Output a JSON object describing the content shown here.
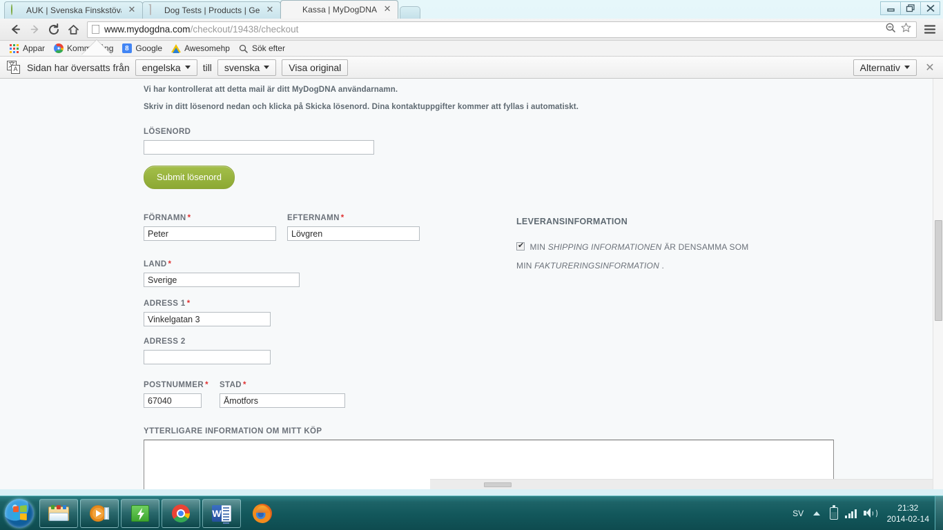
{
  "browser": {
    "tabs": [
      {
        "title": "AUK | Svenska Finskstövar",
        "favicon": "auk-logo-icon",
        "active": false
      },
      {
        "title": "Dog Tests | Products | Gen",
        "favicon": "document-icon",
        "active": false
      },
      {
        "title": "Kassa | MyDogDNA",
        "favicon": "mydogdna-logo-icon",
        "active": true
      }
    ],
    "close_label": "✕",
    "window_controls": {
      "minimize": "minimize-icon",
      "restore": "restore-icon",
      "close": "close-icon"
    },
    "url": {
      "host": "www.mydogdna.com",
      "path": "/checkout/19438/checkout"
    },
    "bookmarks": [
      {
        "label": "Appar",
        "icon": "apps-grid-icon"
      },
      {
        "label": "Komm  igång",
        "icon": "chrome-icon"
      },
      {
        "label": "Google",
        "icon": "google-icon"
      },
      {
        "label": "Awesomehp",
        "icon": "awesomehp-icon"
      },
      {
        "label": "Sök efter",
        "icon": "search-icon"
      }
    ]
  },
  "translate_bar": {
    "message": "Sidan har översatts från",
    "source_language": "engelska",
    "between": "till",
    "target_language": "svenska",
    "show_original": "Visa original",
    "options": "Alternativ",
    "close": "✕"
  },
  "page": {
    "intro": {
      "line1": "Vi har kontrollerat att detta mail är ditt MyDogDNA användarnamn.",
      "line2": "Skriv in ditt lösenord nedan och klicka på Skicka lösenord. Dina kontaktuppgifter kommer att fyllas i automatiskt."
    },
    "password": {
      "label": "LÖSENORD",
      "value": "",
      "submit_label": "Submit lösenord"
    },
    "fields": {
      "first_name": {
        "label": "FÖRNAMN",
        "required": "*",
        "value": "Peter"
      },
      "last_name": {
        "label": "EFTERNAMN",
        "required": "*",
        "value": "Lövgren"
      },
      "country": {
        "label": "LAND",
        "required": "*",
        "value": "Sverige"
      },
      "address1": {
        "label": "ADRESS 1",
        "required": "*",
        "value": "Vinkelgatan 3"
      },
      "address2": {
        "label": "ADRESS 2",
        "required": "",
        "value": ""
      },
      "postcode": {
        "label": "POSTNUMMER",
        "required": "*",
        "value": "67040"
      },
      "city": {
        "label": "STAD",
        "required": "*",
        "value": "Åmotfors"
      },
      "notes": {
        "label": "YTTERLIGARE INFORMATION OM MITT KÖP",
        "value": ""
      }
    },
    "shipping": {
      "heading": "LEVERANSINFORMATION",
      "checkbox_checked": true,
      "text_part1": "MIN ",
      "text_em1": "SHIPPING INFORMATIONEN",
      "text_part2": " ÄR DENSAMMA SOM MIN ",
      "text_em2": "FAKTURERINGSINFORMATION",
      "text_part3": " ."
    }
  },
  "taskbar": {
    "start": "windows-start-orb",
    "items": [
      {
        "name": "file-explorer",
        "icon": "folder-icon"
      },
      {
        "name": "windows-media-player",
        "icon": "media-player-icon"
      },
      {
        "name": "green-app",
        "icon": "green-bolt-icon"
      },
      {
        "name": "google-chrome",
        "icon": "chrome-icon"
      },
      {
        "name": "microsoft-word",
        "icon": "word-icon"
      },
      {
        "name": "mozilla-firefox",
        "icon": "firefox-icon"
      }
    ],
    "tray": {
      "language": "SV",
      "time": "21:32",
      "date": "2014-02-14"
    }
  }
}
